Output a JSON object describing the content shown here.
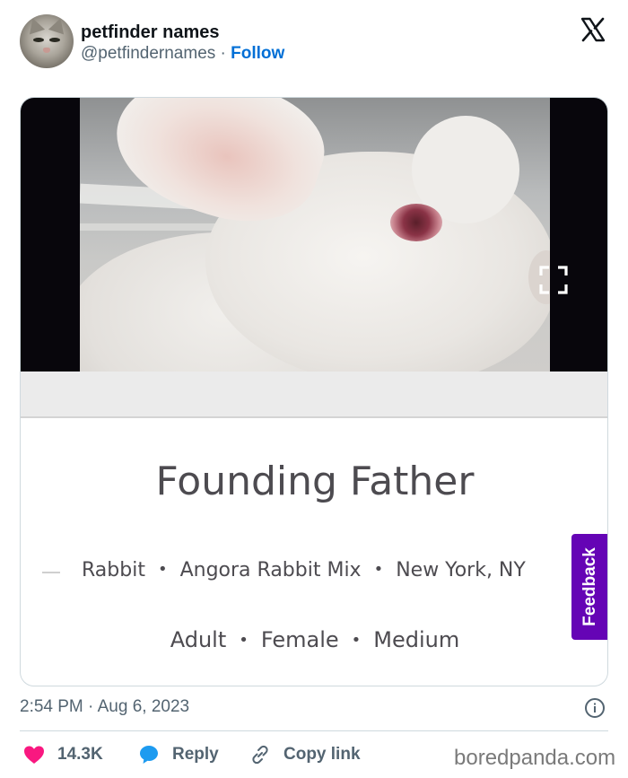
{
  "author": {
    "name": "petfinder names",
    "handle": "@petfindernames",
    "dot": "·",
    "follow_label": "Follow"
  },
  "card": {
    "pet_name": "Founding Father",
    "species": "Rabbit",
    "breed": "Angora Rabbit Mix",
    "location": "New York, NY",
    "age": "Adult",
    "sex": "Female",
    "size": "Medium",
    "separator": "•",
    "feedback_label": "Feedback"
  },
  "tweet": {
    "time": "2:54 PM",
    "dot": "·",
    "date": "Aug 6, 2023"
  },
  "actions": {
    "likes": "14.3K",
    "reply_label": "Reply",
    "copy_label": "Copy link"
  },
  "watermark": "boredpanda.com",
  "colors": {
    "follow": "#006fd6",
    "like": "#f91880",
    "reply": "#1d9bf0",
    "feedback": "#6504b5"
  },
  "icons": [
    "x-logo-icon",
    "expand-icon",
    "info-icon",
    "heart-icon",
    "reply-bubble-icon",
    "link-icon"
  ]
}
